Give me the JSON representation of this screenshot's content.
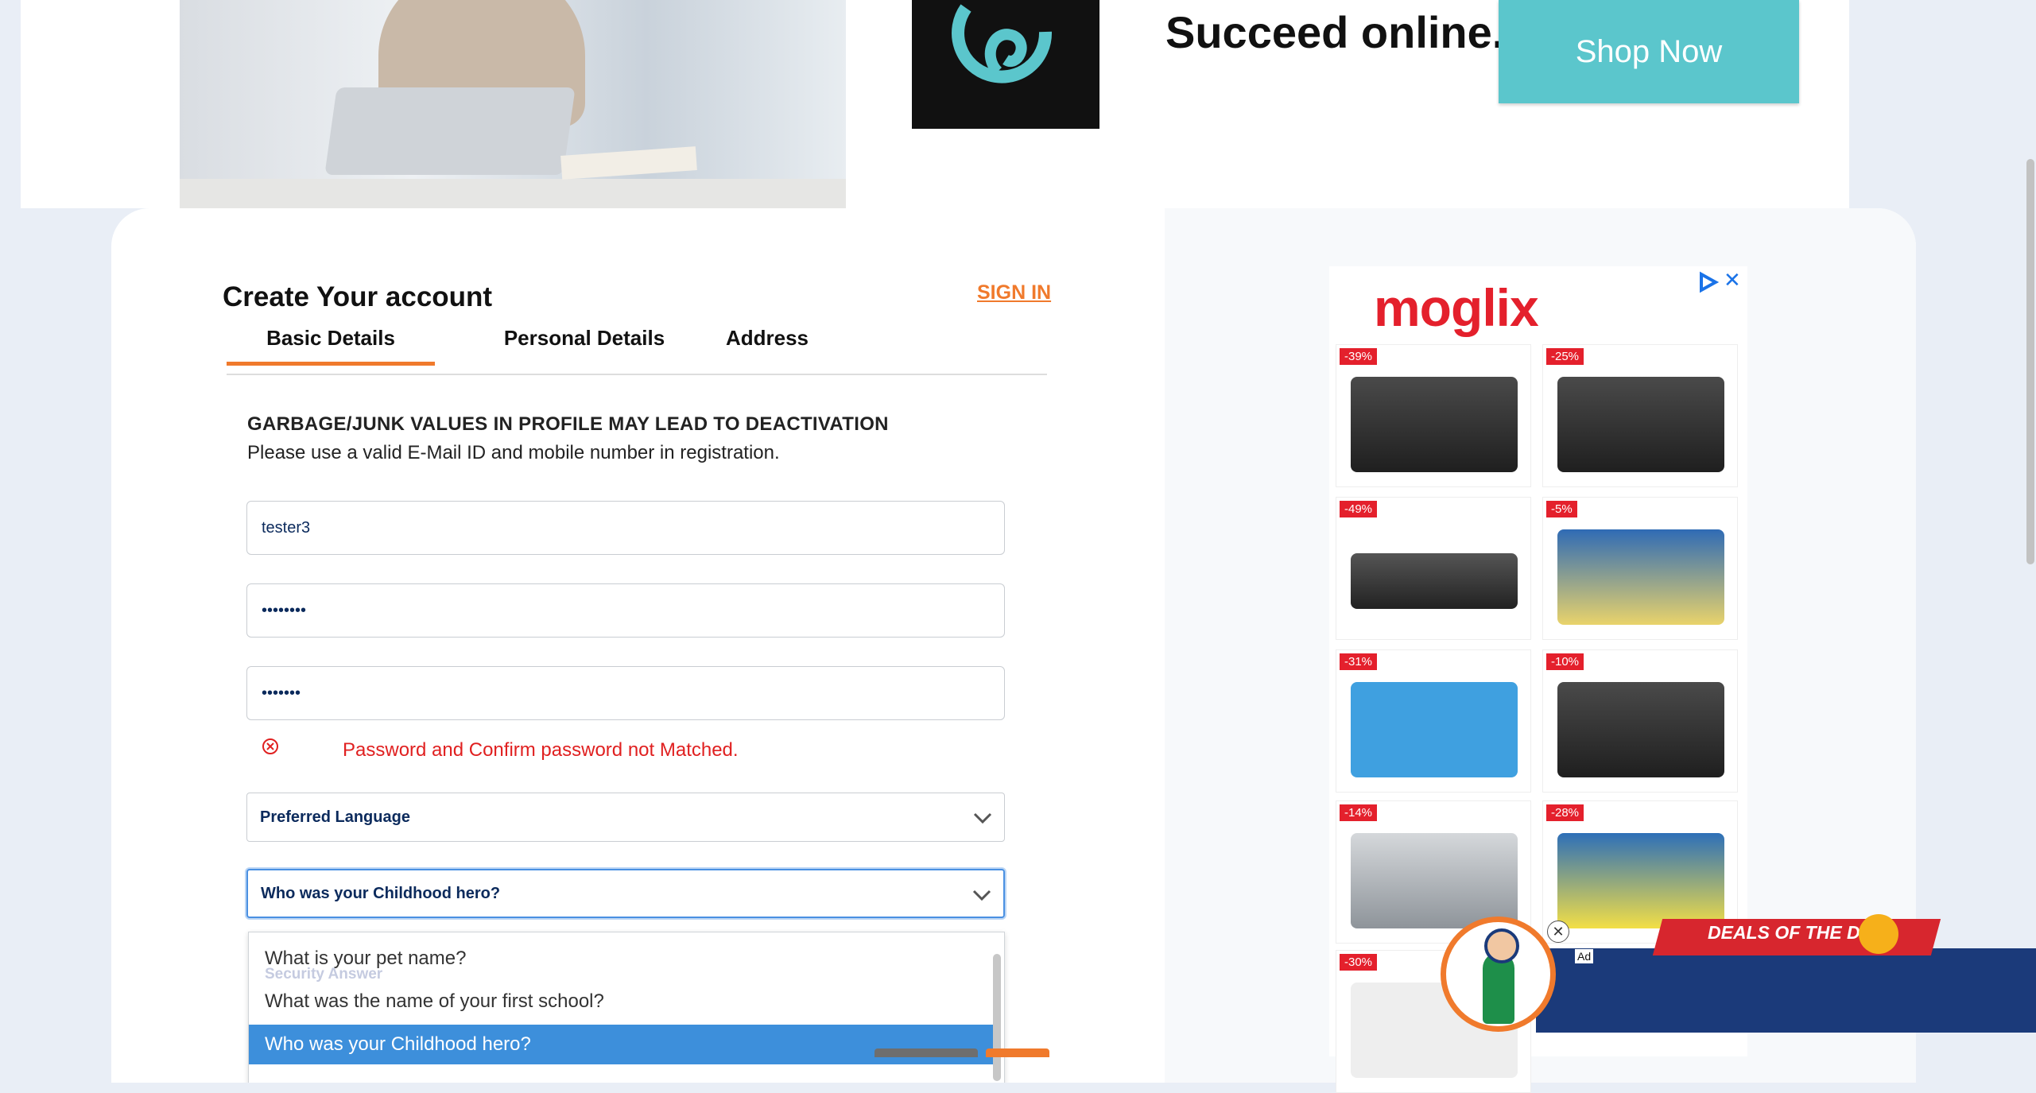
{
  "banner": {
    "headline": "Succeed online.",
    "cta_label": "Shop Now"
  },
  "form": {
    "title": "Create Your account",
    "sign_in_link": "SIGN IN",
    "tabs": [
      {
        "label": "Basic Details",
        "active": true
      },
      {
        "label": "Personal Details",
        "active": false
      },
      {
        "label": "Address",
        "active": false
      }
    ],
    "warning_title": "GARBAGE/JUNK VALUES IN PROFILE MAY LEAD TO DEACTIVATION",
    "warning_text": "Please use a valid E-Mail ID and mobile number in registration.",
    "username_value": "tester3",
    "password_value": "••••••••",
    "confirm_password_value": "•••••••",
    "error_message": "Password and Confirm password not Matched.",
    "language_select_value": "Preferred Language",
    "security_question_value": "Who was your Childhood hero?",
    "security_answer_placeholder": "Security Answer",
    "dropdown_options": [
      "What is your pet name?",
      "What was the name of your first school?",
      "Who was your Childhood hero?"
    ]
  },
  "ad": {
    "brand": "moglix",
    "close_glyph": "✕",
    "discounts": [
      "-39%",
      "-25%",
      "-49%",
      "-5%",
      "-31%",
      "-10%",
      "-14%",
      "-28%",
      "-30%"
    ]
  },
  "sticky_ad": {
    "deals_text": "DEALS OF THE DAY",
    "ad_label": "Ad",
    "close_glyph": "✕"
  },
  "colors": {
    "accent_orange": "#f07a2c",
    "error_red": "#e02020",
    "cta_teal": "#5bc6cc",
    "selected_blue": "#3d8fdb"
  }
}
